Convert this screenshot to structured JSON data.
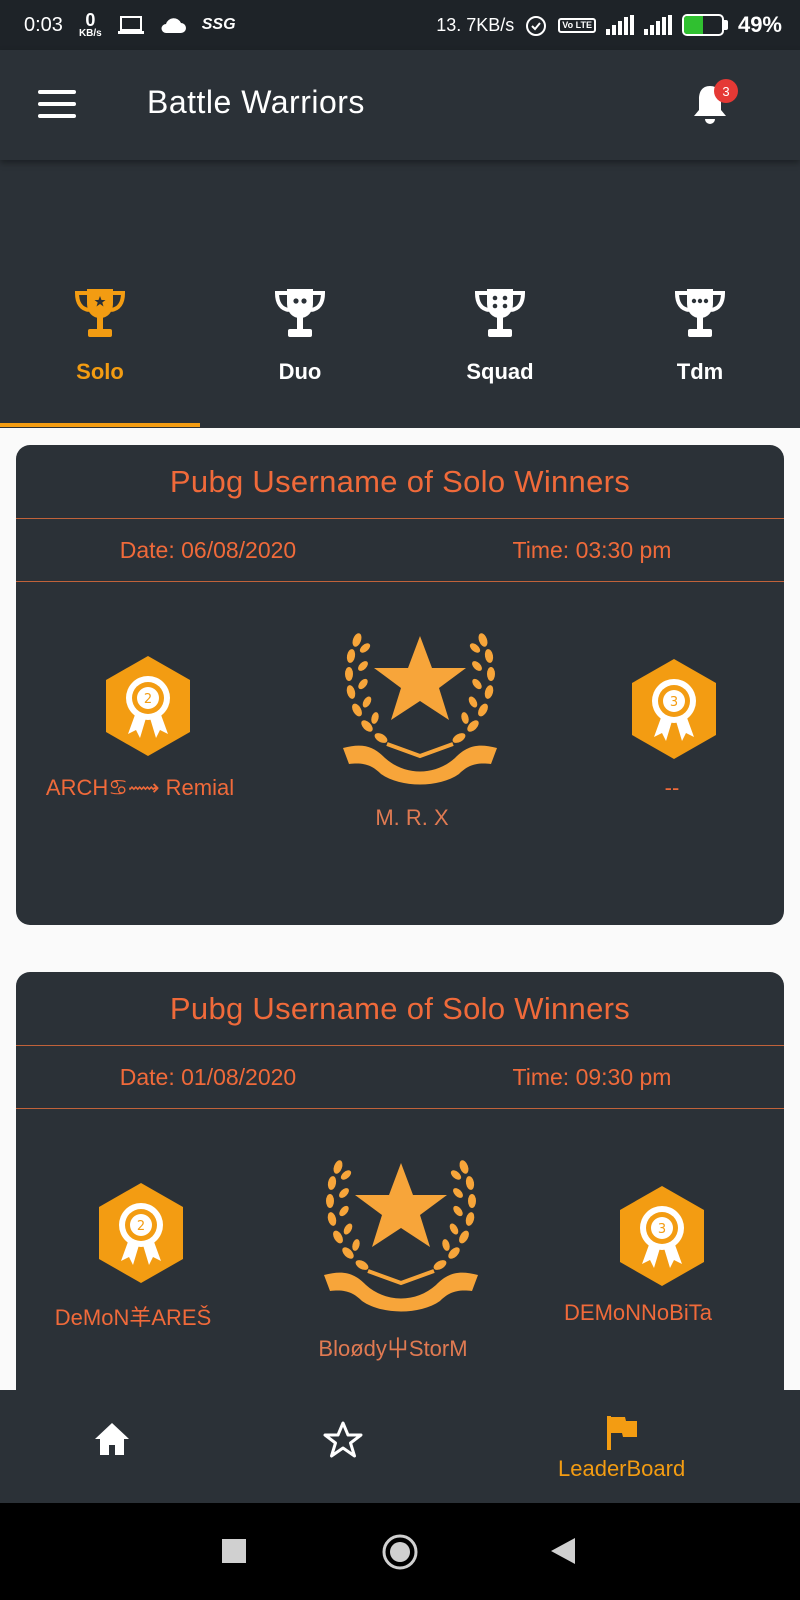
{
  "status_bar": {
    "time": "0:03",
    "speed_value": "0",
    "speed_unit": "KB/s",
    "carrier_tag": "SSG",
    "net_speed": "13. 7KB/s",
    "volte": "Vo LTE",
    "battery_percent": "49%",
    "battery_level": 0.49
  },
  "app_bar": {
    "title": "Battle Warriors",
    "notification_count": "3"
  },
  "tabs": [
    {
      "label": "Solo",
      "active": true
    },
    {
      "label": "Duo",
      "active": false
    },
    {
      "label": "Squad",
      "active": false
    },
    {
      "label": "Tdm",
      "active": false
    }
  ],
  "cards": [
    {
      "title": "Pubg Username of Solo Winners",
      "date": "Date: 06/08/2020",
      "time": "Time: 03:30 pm",
      "second_rank": "2",
      "third_rank": "3",
      "second": "ARCH♋⟿ Remial",
      "first": "M. R. X",
      "third": "--"
    },
    {
      "title": "Pubg Username of Solo Winners",
      "date": "Date: 01/08/2020",
      "time": "Time: 09:30 pm",
      "second_rank": "2",
      "third_rank": "3",
      "second": "DeMoN羊AREŠ",
      "first": "Bloødy屮StorM",
      "third": "DEMoNNoBiTa"
    }
  ],
  "bottom_nav": {
    "home_icon": "home-icon",
    "favorites_icon": "star-outline-icon",
    "leaderboard_icon": "flag-icon",
    "leaderboard_label": "LeaderBoard"
  },
  "colors": {
    "background_dark": "#2b3137",
    "accent": "#f39c12",
    "text_orange": "#f06a3a"
  }
}
